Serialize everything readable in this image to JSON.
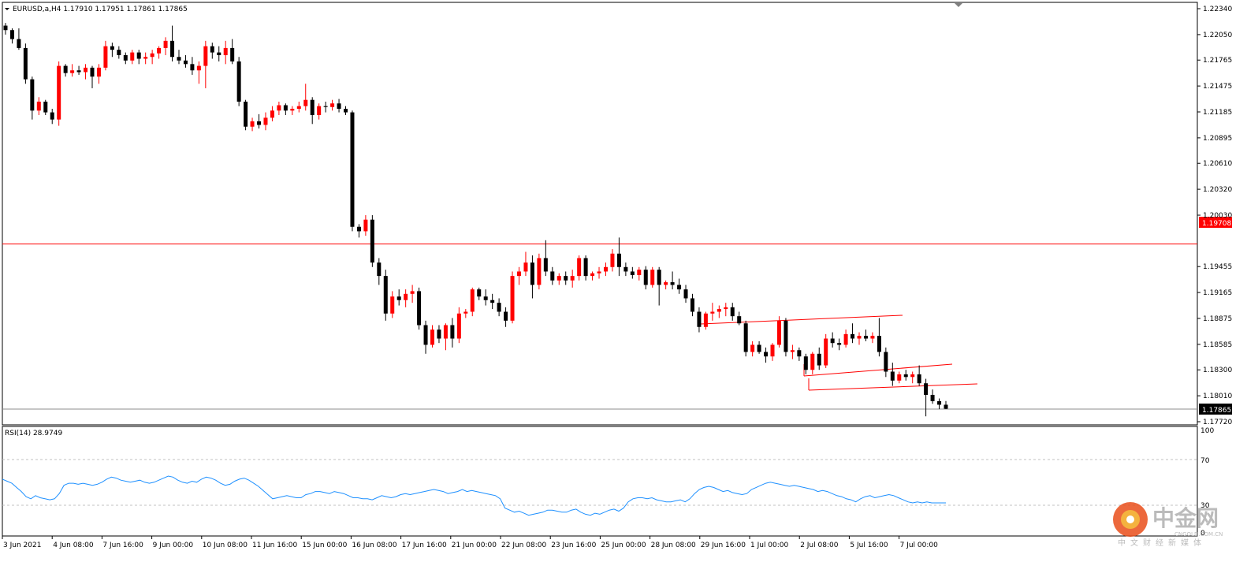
{
  "header": {
    "symbol_line": "EURUSD,a,H4  1.17910 1.17951 1.17861 1.17865"
  },
  "indicator": {
    "label": "RSI(14) 28.9749",
    "levels": [
      "100",
      "70",
      "30",
      "0"
    ]
  },
  "horizontal_line": {
    "label": "1.19708",
    "color": "#ff0000"
  },
  "current_price": {
    "label": "1.17865"
  },
  "watermark": {
    "cn": "中金网",
    "url": "CNGOLD.COM.CN",
    "tagline": "中文财经新媒体"
  },
  "colors": {
    "bull": "#ff0000",
    "bear": "#000000",
    "rsi": "#1e90ff",
    "grid": "#c0c0c0"
  },
  "chart_data": {
    "type": "candlestick",
    "instrument": "EURUSD,a",
    "timeframe": "H4",
    "ylim": [
      1.1772,
      1.2234
    ],
    "y_ticks": [
      "1.22340",
      "1.22050",
      "1.21765",
      "1.21475",
      "1.21185",
      "1.20895",
      "1.20610",
      "1.20320",
      "1.20030",
      "1.19708",
      "1.19455",
      "1.19165",
      "1.18875",
      "1.18585",
      "1.18300",
      "1.18010",
      "1.17865",
      "1.17720"
    ],
    "x_ticks": [
      "3 Jun 2021",
      "4 Jun 08:00",
      "7 Jun 16:00",
      "9 Jun 00:00",
      "10 Jun 08:00",
      "11 Jun 16:00",
      "15 Jun 00:00",
      "16 Jun 08:00",
      "17 Jun 16:00",
      "21 Jun 00:00",
      "22 Jun 08:00",
      "23 Jun 16:00",
      "25 Jun 00:00",
      "28 Jun 08:00",
      "29 Jun 16:00",
      "1 Jul 00:00",
      "2 Jul 08:00",
      "5 Jul 16:00",
      "7 Jul 00:00"
    ],
    "ohlc": [
      [
        1.2215,
        1.2218,
        1.2205,
        1.221
      ],
      [
        1.221,
        1.2212,
        1.2195,
        1.22
      ],
      [
        1.22,
        1.2212,
        1.2188,
        1.219
      ],
      [
        1.219,
        1.2195,
        1.215,
        1.2155
      ],
      [
        1.2155,
        1.2158,
        1.211,
        1.212
      ],
      [
        1.212,
        1.2135,
        1.2115,
        1.213
      ],
      [
        1.213,
        1.2132,
        1.2115,
        1.2118
      ],
      [
        1.2118,
        1.2122,
        1.2105,
        1.211
      ],
      [
        1.211,
        1.2175,
        1.2103,
        1.217
      ],
      [
        1.217,
        1.2172,
        1.2158,
        1.2162
      ],
      [
        1.2162,
        1.2172,
        1.2158,
        1.2165
      ],
      [
        1.2165,
        1.217,
        1.216,
        1.2163
      ],
      [
        1.2163,
        1.2172,
        1.2155,
        1.2168
      ],
      [
        1.2168,
        1.217,
        1.2145,
        1.2158
      ],
      [
        1.2158,
        1.2172,
        1.215,
        1.2168
      ],
      [
        1.2168,
        1.2198,
        1.2165,
        1.2192
      ],
      [
        1.2192,
        1.2196,
        1.218,
        1.2188
      ],
      [
        1.2188,
        1.2192,
        1.2178,
        1.2182
      ],
      [
        1.2182,
        1.2185,
        1.2172,
        1.2176
      ],
      [
        1.2176,
        1.2188,
        1.2172,
        1.2185
      ],
      [
        1.2185,
        1.2188,
        1.2172,
        1.2178
      ],
      [
        1.2178,
        1.2185,
        1.2172,
        1.218
      ],
      [
        1.218,
        1.2188,
        1.2172,
        1.2184
      ],
      [
        1.2184,
        1.2192,
        1.2178,
        1.219
      ],
      [
        1.219,
        1.2202,
        1.2182,
        1.2198
      ],
      [
        1.2198,
        1.2215,
        1.2175,
        1.218
      ],
      [
        1.218,
        1.2188,
        1.2172,
        1.2176
      ],
      [
        1.2176,
        1.2182,
        1.2168,
        1.2172
      ],
      [
        1.2172,
        1.218,
        1.216,
        1.2165
      ],
      [
        1.2165,
        1.2175,
        1.215,
        1.217
      ],
      [
        1.217,
        1.2198,
        1.2145,
        1.2192
      ],
      [
        1.2192,
        1.2196,
        1.2178,
        1.2185
      ],
      [
        1.2185,
        1.2192,
        1.2175,
        1.2182
      ],
      [
        1.2182,
        1.2198,
        1.2172,
        1.219
      ],
      [
        1.219,
        1.22,
        1.2172,
        1.2175
      ],
      [
        1.2175,
        1.218,
        1.2125,
        1.213
      ],
      [
        1.213,
        1.2132,
        1.2098,
        1.2102
      ],
      [
        1.2102,
        1.2112,
        1.2097,
        1.2108
      ],
      [
        1.2108,
        1.2116,
        1.21,
        1.2104
      ],
      [
        1.2104,
        1.2118,
        1.2098,
        1.2112
      ],
      [
        1.2112,
        1.2125,
        1.2108,
        1.212
      ],
      [
        1.212,
        1.213,
        1.2115,
        1.2126
      ],
      [
        1.2126,
        1.2128,
        1.2115,
        1.212
      ],
      [
        1.212,
        1.2125,
        1.2115,
        1.2122
      ],
      [
        1.2122,
        1.213,
        1.2118,
        1.2125
      ],
      [
        1.2125,
        1.215,
        1.212,
        1.2132
      ],
      [
        1.2132,
        1.2135,
        1.2105,
        1.2115
      ],
      [
        1.2115,
        1.2128,
        1.211,
        1.2125
      ],
      [
        1.2125,
        1.213,
        1.2118,
        1.2124
      ],
      [
        1.2124,
        1.2132,
        1.212,
        1.2128
      ],
      [
        1.2128,
        1.2133,
        1.2118,
        1.2122
      ],
      [
        1.2122,
        1.2125,
        1.2115,
        1.2118
      ],
      [
        1.2118,
        1.212,
        1.1985,
        1.199
      ],
      [
        1.199,
        1.1993,
        1.1978,
        1.1985
      ],
      [
        1.1985,
        1.2003,
        1.198,
        1.1998
      ],
      [
        1.1998,
        1.2003,
        1.1945,
        1.195
      ],
      [
        1.195,
        1.1955,
        1.1925,
        1.1935
      ],
      [
        1.1935,
        1.1942,
        1.1885,
        1.1893
      ],
      [
        1.1893,
        1.1918,
        1.1888,
        1.1912
      ],
      [
        1.1912,
        1.192,
        1.1902,
        1.1908
      ],
      [
        1.1908,
        1.192,
        1.19,
        1.1915
      ],
      [
        1.1915,
        1.1925,
        1.1905,
        1.1918
      ],
      [
        1.1918,
        1.1922,
        1.1875,
        1.188
      ],
      [
        1.188,
        1.1885,
        1.1848,
        1.1858
      ],
      [
        1.1858,
        1.188,
        1.1855,
        1.1875
      ],
      [
        1.1875,
        1.188,
        1.186,
        1.1865
      ],
      [
        1.1865,
        1.1882,
        1.1852,
        1.188
      ],
      [
        1.188,
        1.1888,
        1.1855,
        1.1865
      ],
      [
        1.1865,
        1.19,
        1.186,
        1.1893
      ],
      [
        1.1893,
        1.1898,
        1.1888,
        1.1895
      ],
      [
        1.1895,
        1.1922,
        1.189,
        1.192
      ],
      [
        1.192,
        1.1922,
        1.1908,
        1.1912
      ],
      [
        1.1912,
        1.192,
        1.1902,
        1.1908
      ],
      [
        1.1908,
        1.1915,
        1.1898,
        1.1905
      ],
      [
        1.1905,
        1.191,
        1.189,
        1.1895
      ],
      [
        1.1895,
        1.19,
        1.1878,
        1.1885
      ],
      [
        1.1885,
        1.194,
        1.1882,
        1.1935
      ],
      [
        1.1935,
        1.1945,
        1.1925,
        1.194
      ],
      [
        1.194,
        1.1962,
        1.1935,
        1.195
      ],
      [
        1.195,
        1.1958,
        1.191,
        1.1925
      ],
      [
        1.1925,
        1.196,
        1.192,
        1.1955
      ],
      [
        1.1955,
        1.1975,
        1.1935,
        1.194
      ],
      [
        1.194,
        1.1945,
        1.1925,
        1.193
      ],
      [
        1.193,
        1.1938,
        1.1925,
        1.1935
      ],
      [
        1.1935,
        1.194,
        1.1925,
        1.193
      ],
      [
        1.193,
        1.1942,
        1.1922,
        1.1935
      ],
      [
        1.1935,
        1.1958,
        1.193,
        1.1955
      ],
      [
        1.1955,
        1.1958,
        1.193,
        1.1935
      ],
      [
        1.1935,
        1.194,
        1.193,
        1.1938
      ],
      [
        1.1938,
        1.1945,
        1.1932,
        1.194
      ],
      [
        1.194,
        1.195,
        1.1935,
        1.1945
      ],
      [
        1.1945,
        1.1965,
        1.194,
        1.196
      ],
      [
        1.196,
        1.1978,
        1.1935,
        1.1945
      ],
      [
        1.1945,
        1.195,
        1.1935,
        1.194
      ],
      [
        1.194,
        1.1945,
        1.1932,
        1.1936
      ],
      [
        1.1936,
        1.1945,
        1.193,
        1.1942
      ],
      [
        1.1942,
        1.1946,
        1.192,
        1.1925
      ],
      [
        1.1925,
        1.1945,
        1.1922,
        1.1942
      ],
      [
        1.1942,
        1.1945,
        1.1902,
        1.1925
      ],
      [
        1.1925,
        1.193,
        1.192,
        1.1928
      ],
      [
        1.1928,
        1.194,
        1.192,
        1.1925
      ],
      [
        1.1925,
        1.1932,
        1.1915,
        1.192
      ],
      [
        1.192,
        1.1925,
        1.1905,
        1.191
      ],
      [
        1.191,
        1.1915,
        1.189,
        1.1895
      ],
      [
        1.1895,
        1.19,
        1.1872,
        1.1878
      ],
      [
        1.1878,
        1.1895,
        1.1875,
        1.1893
      ],
      [
        1.1893,
        1.1905,
        1.1885,
        1.1895
      ],
      [
        1.1895,
        1.1902,
        1.1888,
        1.1898
      ],
      [
        1.1898,
        1.1905,
        1.189,
        1.19
      ],
      [
        1.19,
        1.1905,
        1.1885,
        1.189
      ],
      [
        1.189,
        1.1895,
        1.188,
        1.1882
      ],
      [
        1.1882,
        1.1885,
        1.1845,
        1.185
      ],
      [
        1.185,
        1.1862,
        1.1845,
        1.1858
      ],
      [
        1.1858,
        1.1862,
        1.1848,
        1.185
      ],
      [
        1.185,
        1.1855,
        1.1838,
        1.1845
      ],
      [
        1.1845,
        1.186,
        1.184,
        1.1858
      ],
      [
        1.1858,
        1.189,
        1.1855,
        1.1885
      ],
      [
        1.1885,
        1.1888,
        1.1845,
        1.185
      ],
      [
        1.185,
        1.1858,
        1.1842,
        1.1852
      ],
      [
        1.1852,
        1.1855,
        1.184,
        1.1845
      ],
      [
        1.1845,
        1.1848,
        1.1825,
        1.183
      ],
      [
        1.183,
        1.185,
        1.1825,
        1.1848
      ],
      [
        1.1848,
        1.1855,
        1.183,
        1.1835
      ],
      [
        1.1835,
        1.187,
        1.1832,
        1.1865
      ],
      [
        1.1865,
        1.1872,
        1.1855,
        1.186
      ],
      [
        1.186,
        1.1865,
        1.1852,
        1.1858
      ],
      [
        1.1858,
        1.1875,
        1.1855,
        1.187
      ],
      [
        1.187,
        1.1882,
        1.186,
        1.1865
      ],
      [
        1.1865,
        1.1872,
        1.1858,
        1.1868
      ],
      [
        1.1868,
        1.1875,
        1.1862,
        1.1865
      ],
      [
        1.1865,
        1.1872,
        1.186,
        1.1868
      ],
      [
        1.1868,
        1.1888,
        1.1845,
        1.185
      ],
      [
        1.185,
        1.1855,
        1.1822,
        1.1828
      ],
      [
        1.1828,
        1.1838,
        1.1812,
        1.1818
      ],
      [
        1.1818,
        1.1828,
        1.1815,
        1.1825
      ],
      [
        1.1825,
        1.183,
        1.1818,
        1.1822
      ],
      [
        1.1822,
        1.1828,
        1.1815,
        1.1825
      ],
      [
        1.1825,
        1.1835,
        1.1812,
        1.1815
      ],
      [
        1.1815,
        1.182,
        1.1778,
        1.1802
      ],
      [
        1.1802,
        1.1808,
        1.1792,
        1.1795
      ],
      [
        1.1795,
        1.1798,
        1.1786,
        1.1791
      ],
      [
        1.1791,
        1.17951,
        1.17861,
        1.17865
      ]
    ],
    "rsi": {
      "name": "RSI(14)",
      "period": 14,
      "last": 28.9749,
      "ylim": [
        0,
        100
      ],
      "levels": [
        30,
        70
      ],
      "values": [
        52,
        50,
        48,
        44,
        40,
        35,
        33,
        36,
        34,
        33,
        32,
        33,
        38,
        46,
        48,
        48,
        47,
        48,
        47,
        46,
        47,
        49,
        52,
        54,
        53,
        51,
        50,
        49,
        50,
        51,
        49,
        48,
        49,
        51,
        53,
        55,
        54,
        51,
        49,
        48,
        50,
        49,
        52,
        54,
        53,
        51,
        48,
        46,
        47,
        50,
        52,
        53,
        51,
        48,
        45,
        41,
        37,
        33,
        34,
        35,
        36,
        35,
        34,
        34,
        37,
        38,
        40,
        40,
        39,
        38,
        40,
        39,
        38,
        36,
        34,
        34,
        33,
        33,
        32,
        34,
        36,
        35,
        34,
        35,
        37,
        38,
        37,
        38,
        39,
        40,
        41,
        42,
        41,
        40,
        38,
        39,
        40,
        42,
        40,
        41,
        40,
        39,
        38,
        37,
        36,
        33,
        24,
        22,
        20,
        21,
        19,
        17,
        18,
        19,
        20,
        22,
        22,
        21,
        20,
        20,
        22,
        23,
        20,
        18,
        17,
        19,
        18,
        20,
        22,
        23,
        21,
        24,
        30,
        33,
        34,
        34,
        33,
        34,
        32,
        31,
        30,
        30,
        31,
        32,
        30,
        33,
        38,
        42,
        44,
        45,
        44,
        42,
        40,
        41,
        39,
        38,
        37,
        38,
        42,
        44,
        46,
        48,
        49,
        48,
        47,
        46,
        45,
        46,
        45,
        44,
        43,
        42,
        40,
        41,
        40,
        38,
        36,
        35,
        33,
        32,
        30,
        33,
        35,
        36,
        34,
        35,
        36,
        37,
        36,
        34,
        32,
        30,
        29,
        30,
        29,
        30,
        29,
        29,
        29,
        28.9749
      ]
    }
  }
}
